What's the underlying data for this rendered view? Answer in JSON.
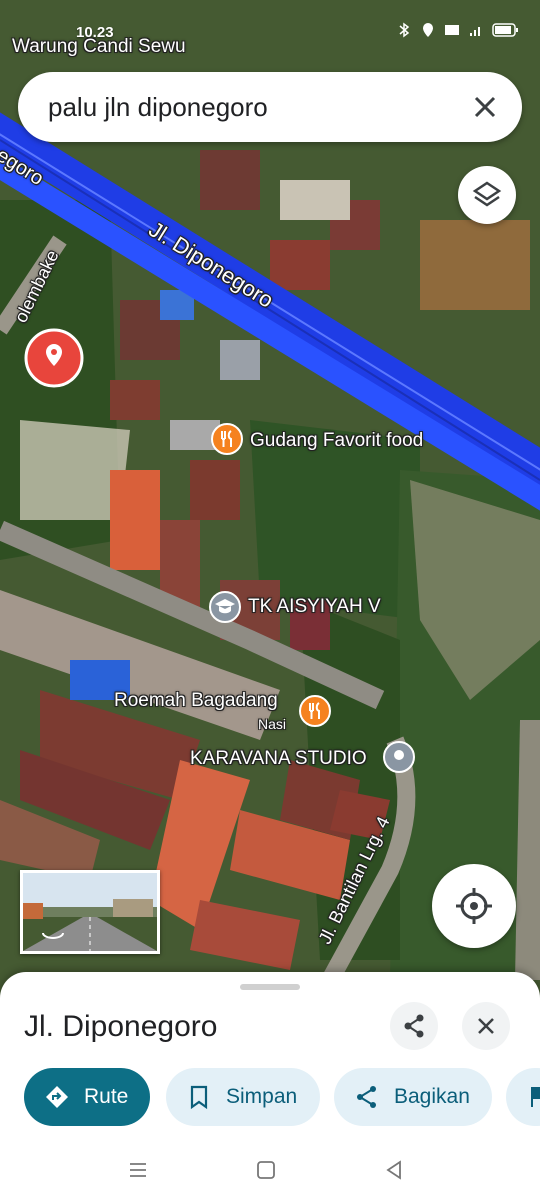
{
  "status": {
    "time": "10.23"
  },
  "search": {
    "query": "palu jln diponegoro"
  },
  "map": {
    "top_place": "Warung Candi Sewu",
    "road_main": "Jl. Diponegoro",
    "road_main_short": "egoro",
    "road_left": "olembake",
    "road_bottom": "Jl. Bantilan Lrg. 4",
    "poi_food": "Gudang Favorit food",
    "poi_school": "TK AISYIYAH V",
    "poi_restaurant": "Roemah Bagadang",
    "poi_restaurant_sub": "Nasi",
    "poi_studio": "KARAVANA STUDIO"
  },
  "sheet": {
    "title": "Jl. Diponegoro",
    "actions": [
      "Rute",
      "Simpan",
      "Bagikan"
    ]
  },
  "colors": {
    "road": "#2a52ff",
    "accent": "#0d6f86",
    "pin": "#e8453c",
    "food": "#f5821f"
  }
}
